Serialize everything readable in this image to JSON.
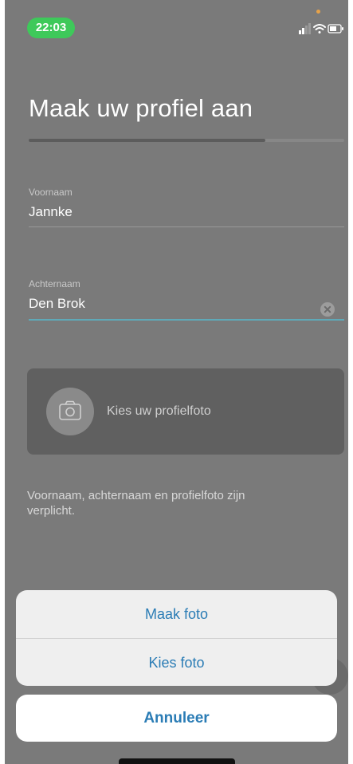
{
  "status_bar": {
    "time": "22:03",
    "icons": [
      "signal-icon",
      "wifi-icon",
      "battery-icon"
    ]
  },
  "header": {
    "title": "Maak uw profiel aan",
    "progress": 0.75
  },
  "form": {
    "first_name": {
      "label": "Voornaam",
      "value": "Jannke"
    },
    "last_name": {
      "label": "Achternaam",
      "value": "Den Brok"
    },
    "photo": {
      "label": "Kies uw profielfoto",
      "icon": "camera-icon"
    },
    "hint": "Voornaam, achternaam en profielfoto zijn verplicht."
  },
  "action_sheet": {
    "items": [
      {
        "label": "Maak foto"
      },
      {
        "label": "Kies foto"
      }
    ],
    "cancel_label": "Annuleer"
  },
  "colors": {
    "accent": "#2a7cb5",
    "status_time_bg": "#3ec95a",
    "overlay_bg": "#7a7a7a",
    "active_underline": "#5fa9b8"
  }
}
